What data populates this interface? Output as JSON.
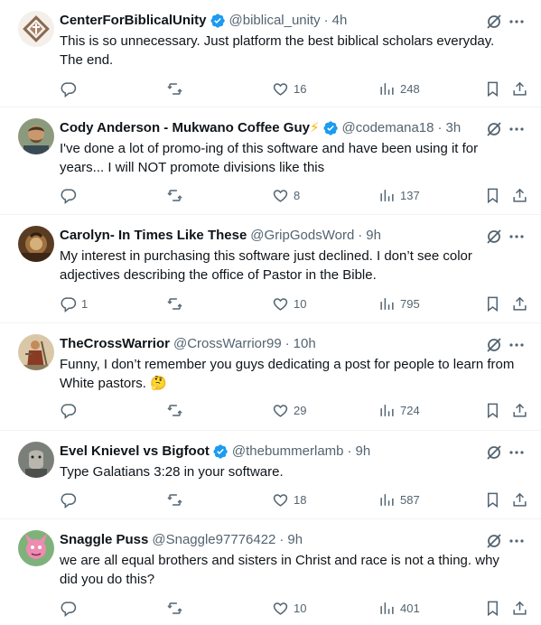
{
  "tweets": [
    {
      "name": "CenterForBiblicalUnity",
      "handle": "@biblical_unity",
      "time": "4h",
      "verified": true,
      "text": "This is so unnecessary. Just platform the best biblical scholars everyday. The end.",
      "replies": "",
      "retweets": "",
      "likes": "16",
      "views": "248"
    },
    {
      "name": "Cody Anderson - Mukwano Coffee Guy",
      "name_emoji": "⚡",
      "handle": "@codemana18",
      "time": "3h",
      "verified": true,
      "text": "I've done a lot of promo-ing of this software and have been using it for years... I will NOT promote divisions like this",
      "replies": "",
      "retweets": "",
      "likes": "8",
      "views": "137"
    },
    {
      "name": "Carolyn- In Times Like These",
      "handle": "@GripGodsWord",
      "time": "9h",
      "verified": false,
      "text": "My interest in purchasing this software just declined. I don’t see color adjectives describing the office of Pastor in the Bible.",
      "replies": "1",
      "retweets": "",
      "likes": "10",
      "views": "795"
    },
    {
      "name": "TheCrossWarrior",
      "handle": "@CrossWarrior99",
      "time": "10h",
      "verified": false,
      "text": "Funny, I don’t remember you guys dedicating a post for people to learn from White pastors. 🤔",
      "replies": "",
      "retweets": "",
      "likes": "29",
      "views": "724"
    },
    {
      "name": "Evel Knievel vs Bigfoot",
      "handle": "@thebummerlamb",
      "time": "9h",
      "verified": true,
      "text": "Type Galatians 3:28 in your software.",
      "replies": "",
      "retweets": "",
      "likes": "18",
      "views": "587"
    },
    {
      "name": "Snaggle Puss",
      "handle": "@Snaggle97776422",
      "time": "9h",
      "verified": false,
      "text": "we are all equal brothers and sisters in Christ and race is not a thing. why did you do this?",
      "replies": "",
      "retweets": "",
      "likes": "10",
      "views": "401"
    }
  ],
  "sep": "·",
  "colors": {
    "text": "#0f1419",
    "muted": "#536471",
    "verified_blue": "#1d9bf0",
    "divider": "#eff3f4"
  },
  "icons": [
    "reply-icon",
    "retweet-icon",
    "like-icon",
    "views-icon",
    "bookmark-icon",
    "share-icon",
    "grok-icon",
    "more-icon",
    "verified-icon"
  ]
}
